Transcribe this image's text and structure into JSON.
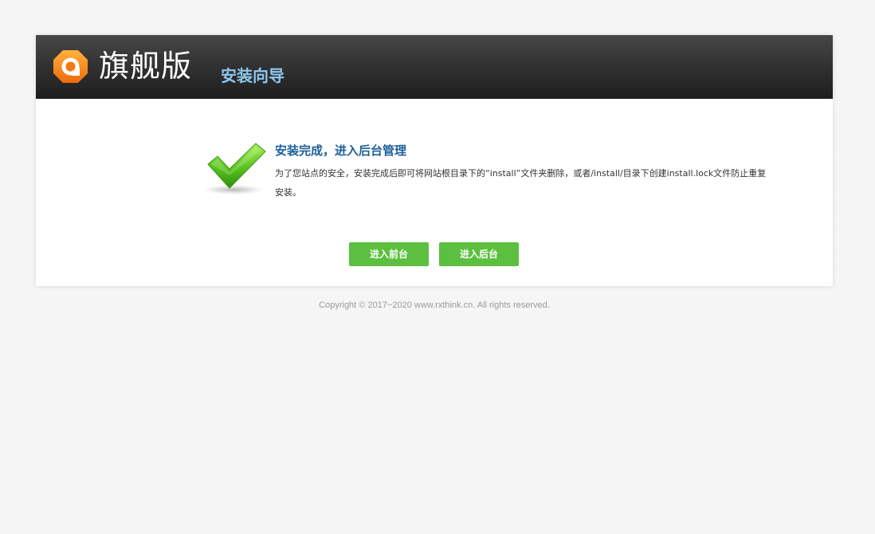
{
  "header": {
    "logo_icon": "orange-q-logo-icon",
    "logo_text": "旗舰版",
    "subtitle": "安装向导"
  },
  "content": {
    "status_icon": "green-checkmark-icon",
    "title": "安装完成，进入后台管理",
    "message": "为了您站点的安全，安装完成后即可将网站根目录下的“install”文件夹删除，或者/install/目录下创建install.lock文件防止重复安装。"
  },
  "buttons": {
    "frontend_label": "进入前台",
    "backend_label": "进入后台"
  },
  "footer": {
    "copyright": "Copyright © 2017~2020 www.rxthink.cn. All rights reserved."
  },
  "colors": {
    "header_dark": "#333333",
    "subtitle_blue": "#8ec8ee",
    "title_blue": "#1d5f9a",
    "button_green": "#5cbf3f",
    "logo_orange": "#f7941d"
  }
}
